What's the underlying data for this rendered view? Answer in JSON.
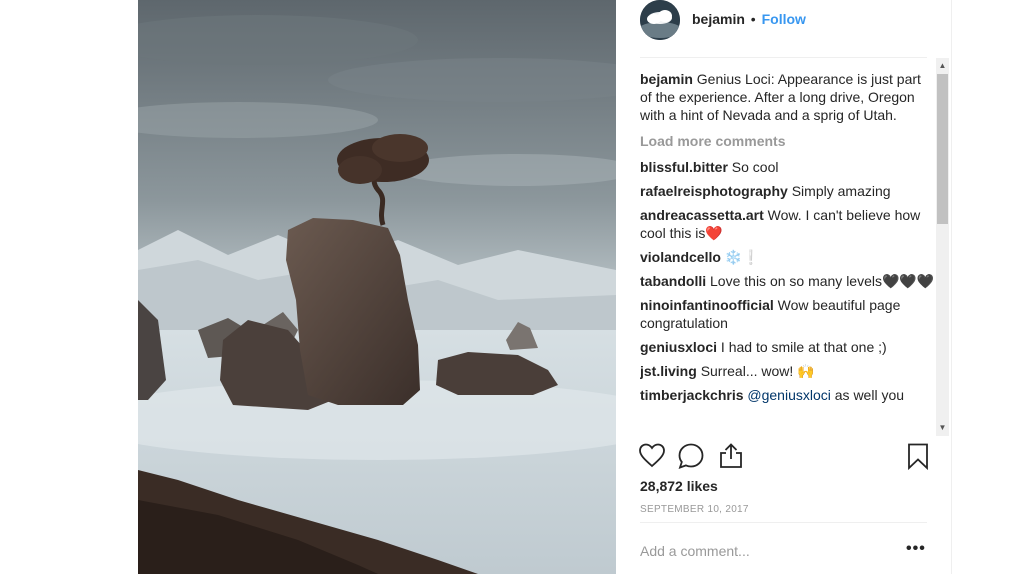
{
  "post": {
    "username": "bejamin",
    "separator": "•",
    "follow_label": "Follow",
    "caption_user": "bejamin",
    "caption_text": "Genius Loci: Appearance is just part of the experience. After a long drive, Oregon with a hint of Nevada and a sprig of Utah.",
    "load_more_label": "Load more comments",
    "comments": [
      {
        "user": "blissful.bitter",
        "text": "So cool"
      },
      {
        "user": "rafaelreisphotography",
        "text": "Simply amazing"
      },
      {
        "user": "andreacassetta.art",
        "text": "Wow. I can't believe how cool this is❤️"
      },
      {
        "user": "violandcello",
        "text": "❄️❕"
      },
      {
        "user": "tabandolli",
        "text": "Love this on so many levels🖤🖤🖤"
      },
      {
        "user": "ninoinfantinoofficial",
        "text": "Wow beautiful page congratulation"
      },
      {
        "user": "geniusxloci",
        "text": "I had to smile at that one ;)"
      },
      {
        "user": "jst.living",
        "text": "Surreal... wow! 🙌"
      },
      {
        "user": "timberjackchris",
        "mention": "@geniusxloci",
        "text": "as well you"
      }
    ],
    "likes": "28,872 likes",
    "date": "SEPTEMBER 10, 2017",
    "add_comment_placeholder": "Add a comment...",
    "more_options_label": "•••"
  },
  "icons": {
    "avatar": "cloud-avatar",
    "like": "heart-icon",
    "comment": "comment-bubble-icon",
    "share": "share-icon",
    "save": "bookmark-icon"
  },
  "colors": {
    "follow": "#3897f0",
    "text": "#262626",
    "muted": "#999999"
  }
}
